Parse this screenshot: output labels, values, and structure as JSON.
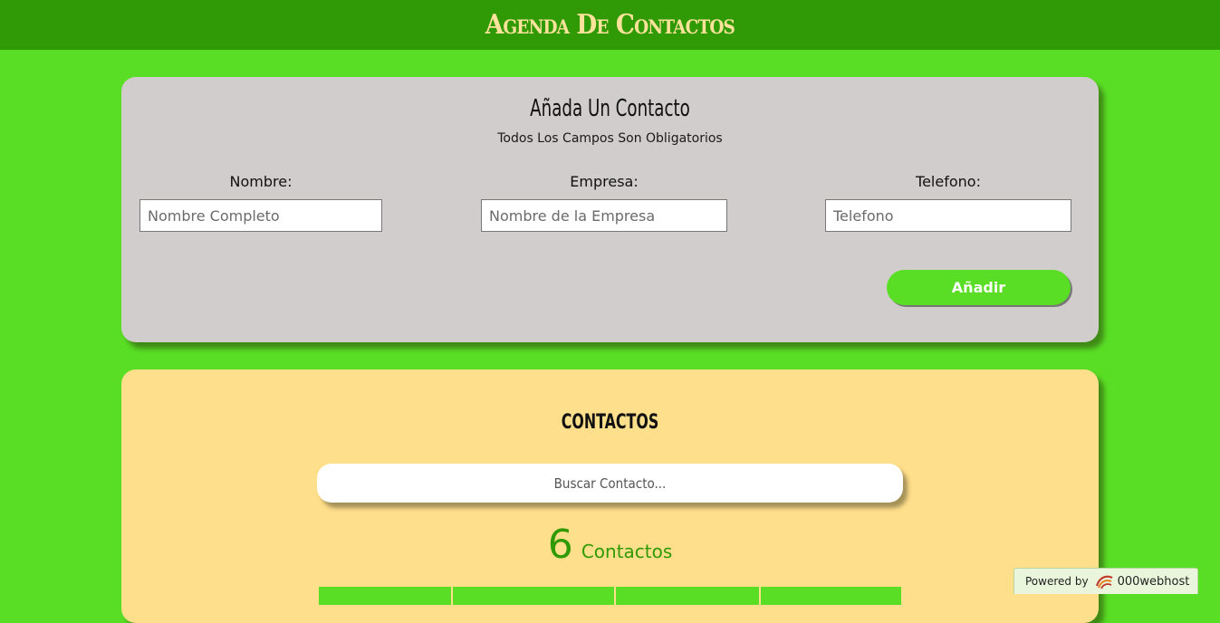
{
  "header": {
    "title": "Agenda De Contactos"
  },
  "form": {
    "title": "Añada Un Contacto",
    "subtitle": "Todos Los Campos Son Obligatorios",
    "fields": [
      {
        "label": "Nombre:",
        "placeholder": "Nombre Completo"
      },
      {
        "label": "Empresa:",
        "placeholder": "Nombre de la Empresa"
      },
      {
        "label": "Telefono:",
        "placeholder": "Telefono"
      }
    ],
    "submit_label": "Añadir"
  },
  "contacts": {
    "title": "CONTACTOS",
    "search_placeholder": "Buscar Contacto...",
    "count": "6",
    "count_label": "Contactos"
  },
  "footer_badge": {
    "prefix": "Powered by",
    "brand": "000webhost",
    "icon": "000webhost-logo-icon"
  },
  "colors": {
    "page_bg": "#5ade25",
    "header_bg": "#2f9a05",
    "title_color": "#fce29a",
    "form_card": "#d1cdcc",
    "contacts_card": "#fedf8b"
  }
}
